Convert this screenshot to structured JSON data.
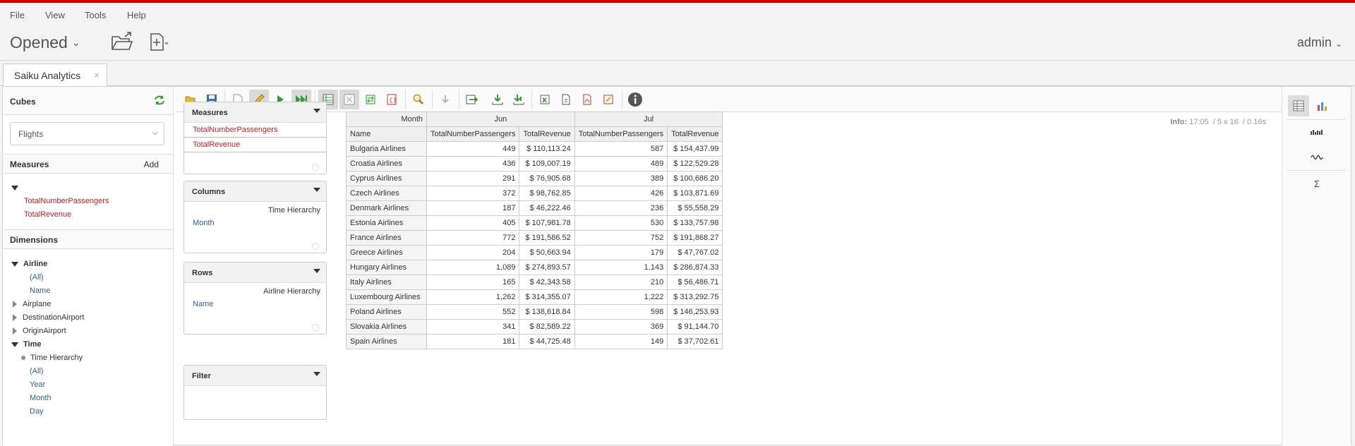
{
  "menu": {
    "file": "File",
    "view": "View",
    "tools": "Tools",
    "help": "Help"
  },
  "header": {
    "opened_label": "Opened",
    "user": "admin"
  },
  "tab": {
    "label": "Saiku Analytics",
    "close": "×"
  },
  "sidebar": {
    "cubes_title": "Cubes",
    "cube_selected": "Flights",
    "measures_title": "Measures",
    "add_label": "Add",
    "measures": [
      "TotalNumberPassengers",
      "TotalRevenue"
    ],
    "dimensions_title": "Dimensions",
    "dims": {
      "airline": "Airline",
      "airline_all": "(All)",
      "airline_name": "Name",
      "airplane": "Airplane",
      "destination": "DestinationAirport",
      "origin": "OriginAirport",
      "time": "Time",
      "time_hierarchy": "Time Hierarchy",
      "time_all": "(All)",
      "year": "Year",
      "month": "Month",
      "day": "Day"
    }
  },
  "info": {
    "label": "Info:",
    "time": "17:05",
    "size": "5 x 16",
    "duration": "0.16s"
  },
  "panels": {
    "measures": {
      "title": "Measures",
      "items": [
        "TotalNumberPassengers",
        "TotalRevenue"
      ]
    },
    "columns": {
      "title": "Columns",
      "hierarchy": "Time Hierarchy",
      "level": "Month"
    },
    "rows": {
      "title": "Rows",
      "hierarchy": "Airline Hierarchy",
      "level": "Name"
    },
    "filter": {
      "title": "Filter"
    }
  },
  "pivot": {
    "corner_month": "Month",
    "corner_name": "Name",
    "months": [
      "Jun",
      "Jul"
    ],
    "measure_headers": [
      "TotalNumberPassengers",
      "TotalRevenue",
      "TotalNumberPassengers",
      "TotalRevenue"
    ],
    "rows": [
      [
        "Bulgaria Airlines",
        "449",
        "$ 110,113.24",
        "587",
        "$ 154,437.99"
      ],
      [
        "Croatia Airlines",
        "436",
        "$ 109,007.19",
        "489",
        "$ 122,529.28"
      ],
      [
        "Cyprus Airlines",
        "291",
        "$ 76,905.68",
        "389",
        "$ 100,686.20"
      ],
      [
        "Czech Airlines",
        "372",
        "$ 98,762.85",
        "426",
        "$ 103,871.69"
      ],
      [
        "Denmark Airlines",
        "187",
        "$ 46,222.46",
        "236",
        "$ 55,558.29"
      ],
      [
        "Estonia Airlines",
        "405",
        "$ 107,981.78",
        "530",
        "$ 133,757.98"
      ],
      [
        "France Airlines",
        "772",
        "$ 191,586.52",
        "752",
        "$ 191,868.27"
      ],
      [
        "Greece Airlines",
        "204",
        "$ 50,663.94",
        "179",
        "$ 47,767.02"
      ],
      [
        "Hungary Airlines",
        "1,089",
        "$ 274,893.57",
        "1,143",
        "$ 286,874.33"
      ],
      [
        "Italy Airlines",
        "165",
        "$ 42,343.58",
        "210",
        "$ 56,486.71"
      ],
      [
        "Luxembourg Airlines",
        "1,262",
        "$ 314,355.07",
        "1,222",
        "$ 313,292.75"
      ],
      [
        "Poland Airlines",
        "552",
        "$ 138,618.84",
        "598",
        "$ 146,253.93"
      ],
      [
        "Slovakia Airlines",
        "341",
        "$ 82,589.22",
        "369",
        "$ 91,144.70"
      ],
      [
        "Spain Airlines",
        "181",
        "$ 44,725.48",
        "149",
        "$ 37,702.61"
      ]
    ]
  },
  "rightbar": {
    "sum_symbol": "Σ"
  },
  "colors": {
    "accent": "#cc0000",
    "measure": "#b22222",
    "level": "#2d5f9a"
  }
}
